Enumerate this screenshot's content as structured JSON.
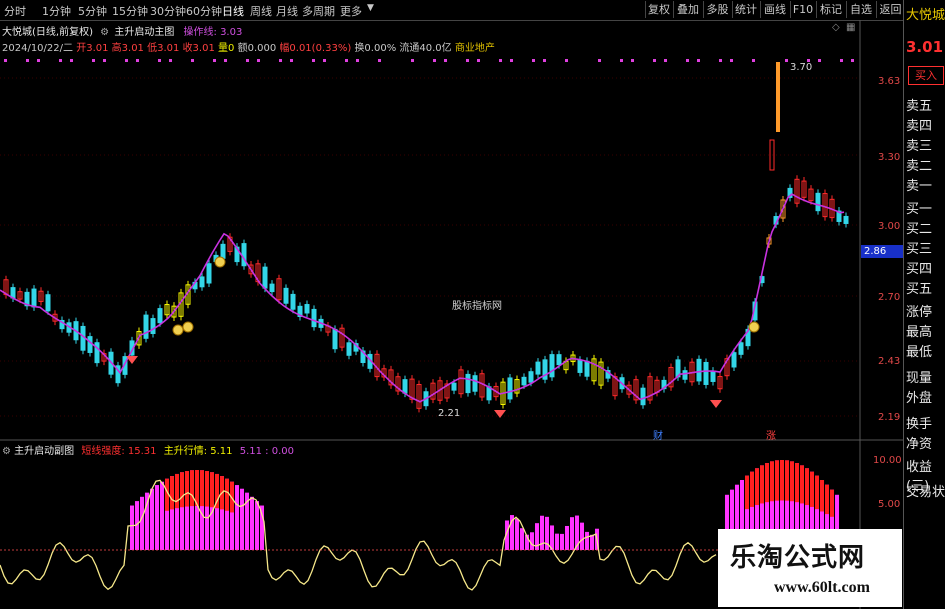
{
  "stock_name": "大悦城",
  "periods": [
    "分时",
    "1分钟",
    "5分钟",
    "15分钟",
    "30分钟",
    "60分钟",
    "日线",
    "周线",
    "月线",
    "多周期",
    "更多"
  ],
  "active_period": "日线",
  "toolbar_buttons": [
    "复权",
    "叠加",
    "多股",
    "统计",
    "画线",
    "F10",
    "标记",
    "自选",
    "返回"
  ],
  "header": {
    "title": "大悦城(日线,前复权)",
    "indicator_name": "主升启动主图",
    "op_line": "操作线: 3.03"
  },
  "info_row": {
    "date": "2024/10/22/二",
    "open": "开3.01",
    "high": "高3.01",
    "low": "低3.01",
    "close": "收3.01",
    "vol": "量0",
    "amount": "额0.000",
    "change": "幅0.01(0.33%)",
    "turnover": "换0.00%",
    "float": "流通40.0亿",
    "sector": "商业地产"
  },
  "right_panel": {
    "name": "大悦城",
    "price": "3.01",
    "buy_btn": "买入",
    "orderbook": [
      "卖五",
      "卖四",
      "卖三",
      "卖二",
      "卖一",
      "买一",
      "买二",
      "买三",
      "买四",
      "买五",
      "涨停",
      "最高",
      "最低",
      "现量",
      "外盘",
      "换手",
      "净资",
      "收益(三)",
      "交易状"
    ]
  },
  "y_axis_main": [
    "3.63",
    "3.30",
    "3.00",
    "2.70",
    "2.43",
    "2.19"
  ],
  "current_price_tag": "2.86",
  "price_annotations": {
    "high": "3.70",
    "low": "2.21"
  },
  "watermark": "股标指标网",
  "event_labels": [
    "财",
    "涨"
  ],
  "sub_panel": {
    "name": "主升启动副图",
    "label1": "短线强度: 15.31",
    "label2": "主升行情: 5.11",
    "label3": "5.11 : 0.00",
    "y_axis": [
      "10.00",
      "5.00"
    ]
  },
  "logo": {
    "name": "乐淘公式网",
    "url": "www.60lt.com"
  },
  "colors": {
    "up": "#ff2a2a",
    "down": "#33d6e8",
    "yellow": "#f7f700",
    "orange": "#ff9a2a",
    "ma": "#c832e0",
    "magenta": "#ff33ff",
    "red": "#ff2020",
    "sublime": "#f6e88a"
  }
}
